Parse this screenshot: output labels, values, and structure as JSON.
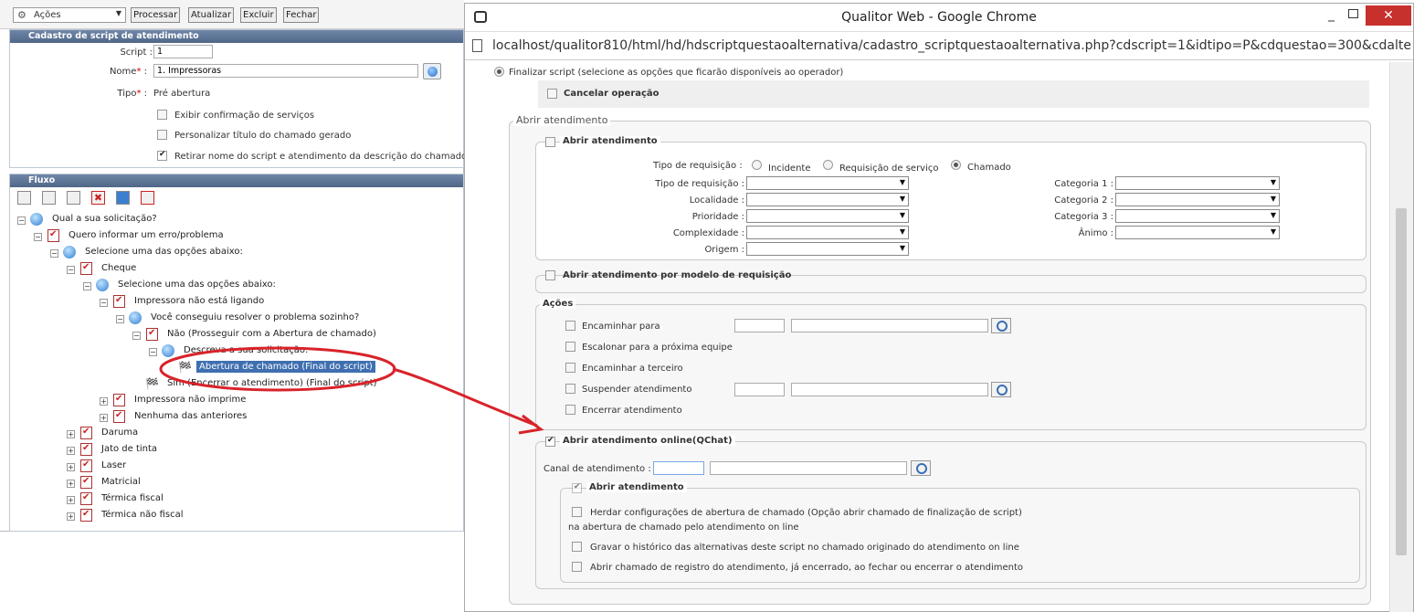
{
  "left": {
    "toolbar": {
      "actions": "Ações",
      "b1": "Processar",
      "b2": "Atualizar",
      "b3": "Excluir",
      "b4": "Fechar"
    },
    "cadastro": {
      "title": "Cadastro de script de atendimento",
      "script_label": "Script :",
      "script_value": "1",
      "nome_label": "Nome",
      "nome_value": "1. Impressoras",
      "tipo_label": "Tipo",
      "tipo_value": "Pré abertura",
      "opt1": "Exibir confirmação de serviços",
      "opt2": "Personalizar título do chamado gerado",
      "opt3": "Retirar nome do script e atendimento da descrição do chamado"
    },
    "fluxo": {
      "title": "Fluxo",
      "tree": [
        {
          "label": "Qual a sua solicitação?"
        },
        {
          "label": "Quero informar um erro/problema"
        },
        {
          "label": "Selecione uma das opções abaixo:"
        },
        {
          "label": "Cheque"
        },
        {
          "label": "Selecione uma das opções abaixo:"
        },
        {
          "label": "Impressora não está ligando"
        },
        {
          "label": "Você conseguiu resolver o problema sozinho?"
        },
        {
          "label": "Não (Prosseguir com a Abertura de chamado)"
        },
        {
          "label": "Descreva a sua solicitação:"
        },
        {
          "label": "Abertura de chamado (Final do script)"
        },
        {
          "label": "Sim (Encerrar o atendimento) (Final do script)"
        },
        {
          "label": "Impressora não imprime"
        },
        {
          "label": "Nenhuma das anteriores"
        },
        {
          "label": "Daruma"
        },
        {
          "label": "Jato de tinta"
        },
        {
          "label": "Laser"
        },
        {
          "label": "Matricial"
        },
        {
          "label": "Térmica fiscal"
        },
        {
          "label": "Térmica não fiscal"
        }
      ]
    }
  },
  "chrome": {
    "title": "Qualitor Web - Google Chrome",
    "url": "localhost/qualitor810/html/hd/hdscriptquestaoalternativa/cadastro_scriptquestaoalternativa.php?cdscript=1&idtipo=P&cdquestao=300&cdalte"
  },
  "form": {
    "finalizar": "Finalizar script (selecione as opções que ficarão disponíveis ao operador)",
    "cancelar": "Cancelar operação",
    "abrir_legend": "Abrir atendimento",
    "abrir_cb": "Abrir atendimento",
    "tipo_req_label": "Tipo de requisição :",
    "radio1": "Incidente",
    "radio2": "Requisição de serviço",
    "radio3": "Chamado",
    "fields_left": [
      "Tipo de requisição :",
      "Localidade :",
      "Prioridade :",
      "Complexidade :",
      "Origem :"
    ],
    "fields_right": [
      "Categoria 1 :",
      "Categoria 2 :",
      "Categoria 3 :",
      "Ânimo :"
    ],
    "modelo": "Abrir atendimento por modelo de requisição",
    "acoes_legend": "Ações",
    "acoes": [
      "Encaminhar para",
      "Escalonar para a próxima equipe",
      "Encaminhar a terceiro",
      "Suspender atendimento",
      "Encerrar atendimento"
    ],
    "online": "Abrir atendimento online(QChat)",
    "canal_label": "Canal de atendimento :",
    "sub_abrir": "Abrir atendimento",
    "herdar1": "Herdar configurações de abertura de chamado (Opção abrir chamado de finalização de script)",
    "herdar2": "na abertura de chamado pelo atendimento on line",
    "gravar": "Gravar o histórico das alternativas deste script no chamado originado do atendimento on line",
    "registro": "Abrir chamado de registro do atendimento, já encerrado, ao fechar ou encerrar o atendimento"
  },
  "accent": "#d9232a"
}
